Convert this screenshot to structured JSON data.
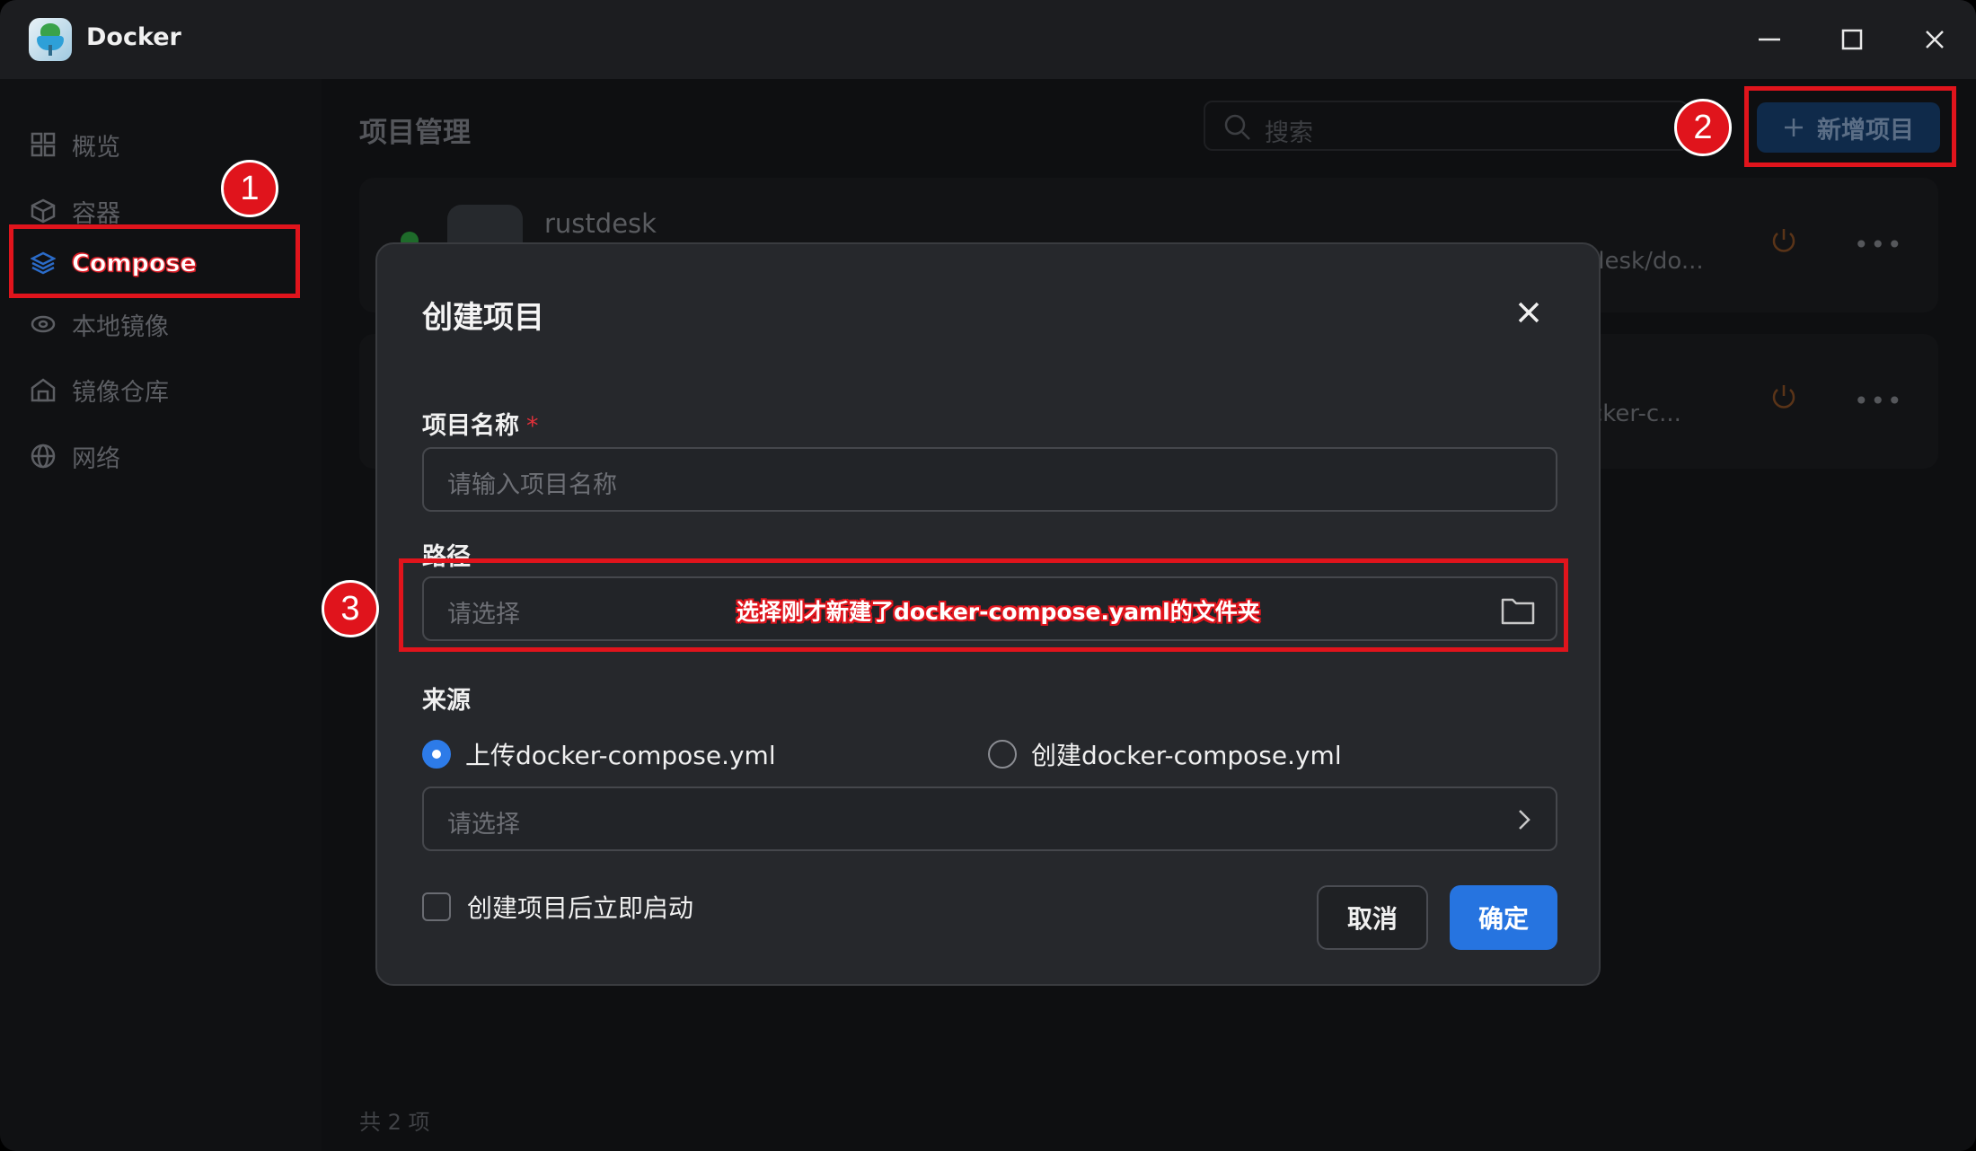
{
  "window": {
    "title": "Docker"
  },
  "sidebar": {
    "items": [
      {
        "label": "概览",
        "icon": "grid-icon"
      },
      {
        "label": "容器",
        "icon": "cube-icon"
      },
      {
        "label": "Compose",
        "icon": "layers-icon",
        "active": true
      },
      {
        "label": "本地镜像",
        "icon": "disk-icon"
      },
      {
        "label": "镜像仓库",
        "icon": "warehouse-icon"
      },
      {
        "label": "网络",
        "icon": "globe-icon"
      }
    ]
  },
  "main": {
    "title": "项目管理",
    "search_placeholder": "搜索",
    "add_button": "新增项目",
    "projects": [
      {
        "name": "rustdesk",
        "path": "desk/do..."
      },
      {
        "name": "",
        "path": "cker-c..."
      }
    ],
    "footer_count": "共 2 项"
  },
  "modal": {
    "title": "创建项目",
    "name_label": "项目名称",
    "required_mark": "*",
    "name_placeholder": "请输入项目名称",
    "path_label": "路径",
    "path_placeholder": "请选择",
    "source_label": "来源",
    "source_options": [
      "上传docker-compose.yml",
      "创建docker-compose.yml"
    ],
    "source_selected": 0,
    "file_placeholder": "请选择",
    "autostart_label": "创建项目后立即启动",
    "cancel": "取消",
    "confirm": "确定"
  },
  "annotations": {
    "badges": [
      "1",
      "2",
      "3"
    ],
    "note": "选择刚才新建了docker-compose.yaml的文件夹",
    "color": "#e0141c"
  },
  "colors": {
    "accent": "#2674e0",
    "annotation": "#e0141c"
  }
}
